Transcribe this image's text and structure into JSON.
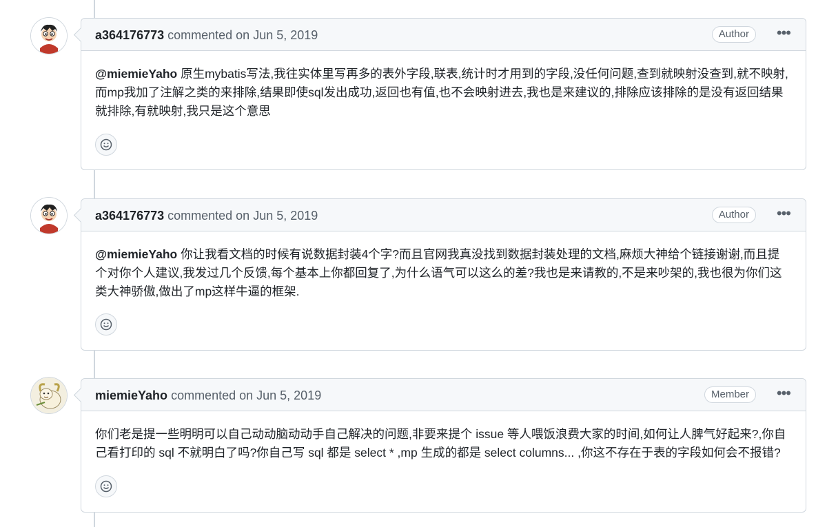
{
  "comments": [
    {
      "author": "a364176773",
      "action": "commented on Jun 5, 2019",
      "badge": "Author",
      "menu_icon": "kebab-horizontal-icon",
      "avatar_icon": "cartoon-boy-avatar",
      "mention": "@miemieYaho",
      "lines": [
        " 原生mybatis写法,我往实体里写再多的表外字段,联表,统计时才用到的字段,没任何问题,查到就映射没查到,就不映射,",
        "而mp我加了注解之类的来排除,结果即使sql发出成功,返回也有值,也不会映射进去,我也是来建议的,排除应该排除的是没有返回结果",
        "就排除,有就映射,我只是这个意思"
      ],
      "reaction_icon": "smiley-icon"
    },
    {
      "author": "a364176773",
      "action": "commented on Jun 5, 2019",
      "badge": "Author",
      "menu_icon": "kebab-horizontal-icon",
      "avatar_icon": "cartoon-boy-avatar",
      "mention": "@miemieYaho",
      "lines": [
        " 你让我看文档的时候有说数据封装4个字?而且官网我真没找到数据封装处理的文档,麻烦大神给个链接谢谢,而且提",
        "个对你个人建议,我发过几个反馈,每个基本上你都回复了,为什么语气可以这么的差?我也是来请教的,不是来吵架的,我也很为你们这",
        "类大神骄傲,做出了mp这样牛逼的框架."
      ],
      "reaction_icon": "smiley-icon"
    },
    {
      "author": "miemieYaho",
      "action": "commented on Jun 5, 2019",
      "badge": "Member",
      "menu_icon": "kebab-horizontal-icon",
      "avatar_icon": "cartoon-goat-avatar",
      "mention": "",
      "lines": [
        "你们老是提一些明明可以自己动动脑动动手自己解决的问题,非要来提个 issue 等人喂饭浪费大家的时间,如何让人脾气好起来?,你自",
        "己看打印的 sql 不就明白了吗?你自己写 sql 都是 select * ,mp 生成的都是 select columns... ,你这不存在于表的字段如何会不报错?"
      ],
      "reaction_icon": "smiley-icon"
    }
  ]
}
